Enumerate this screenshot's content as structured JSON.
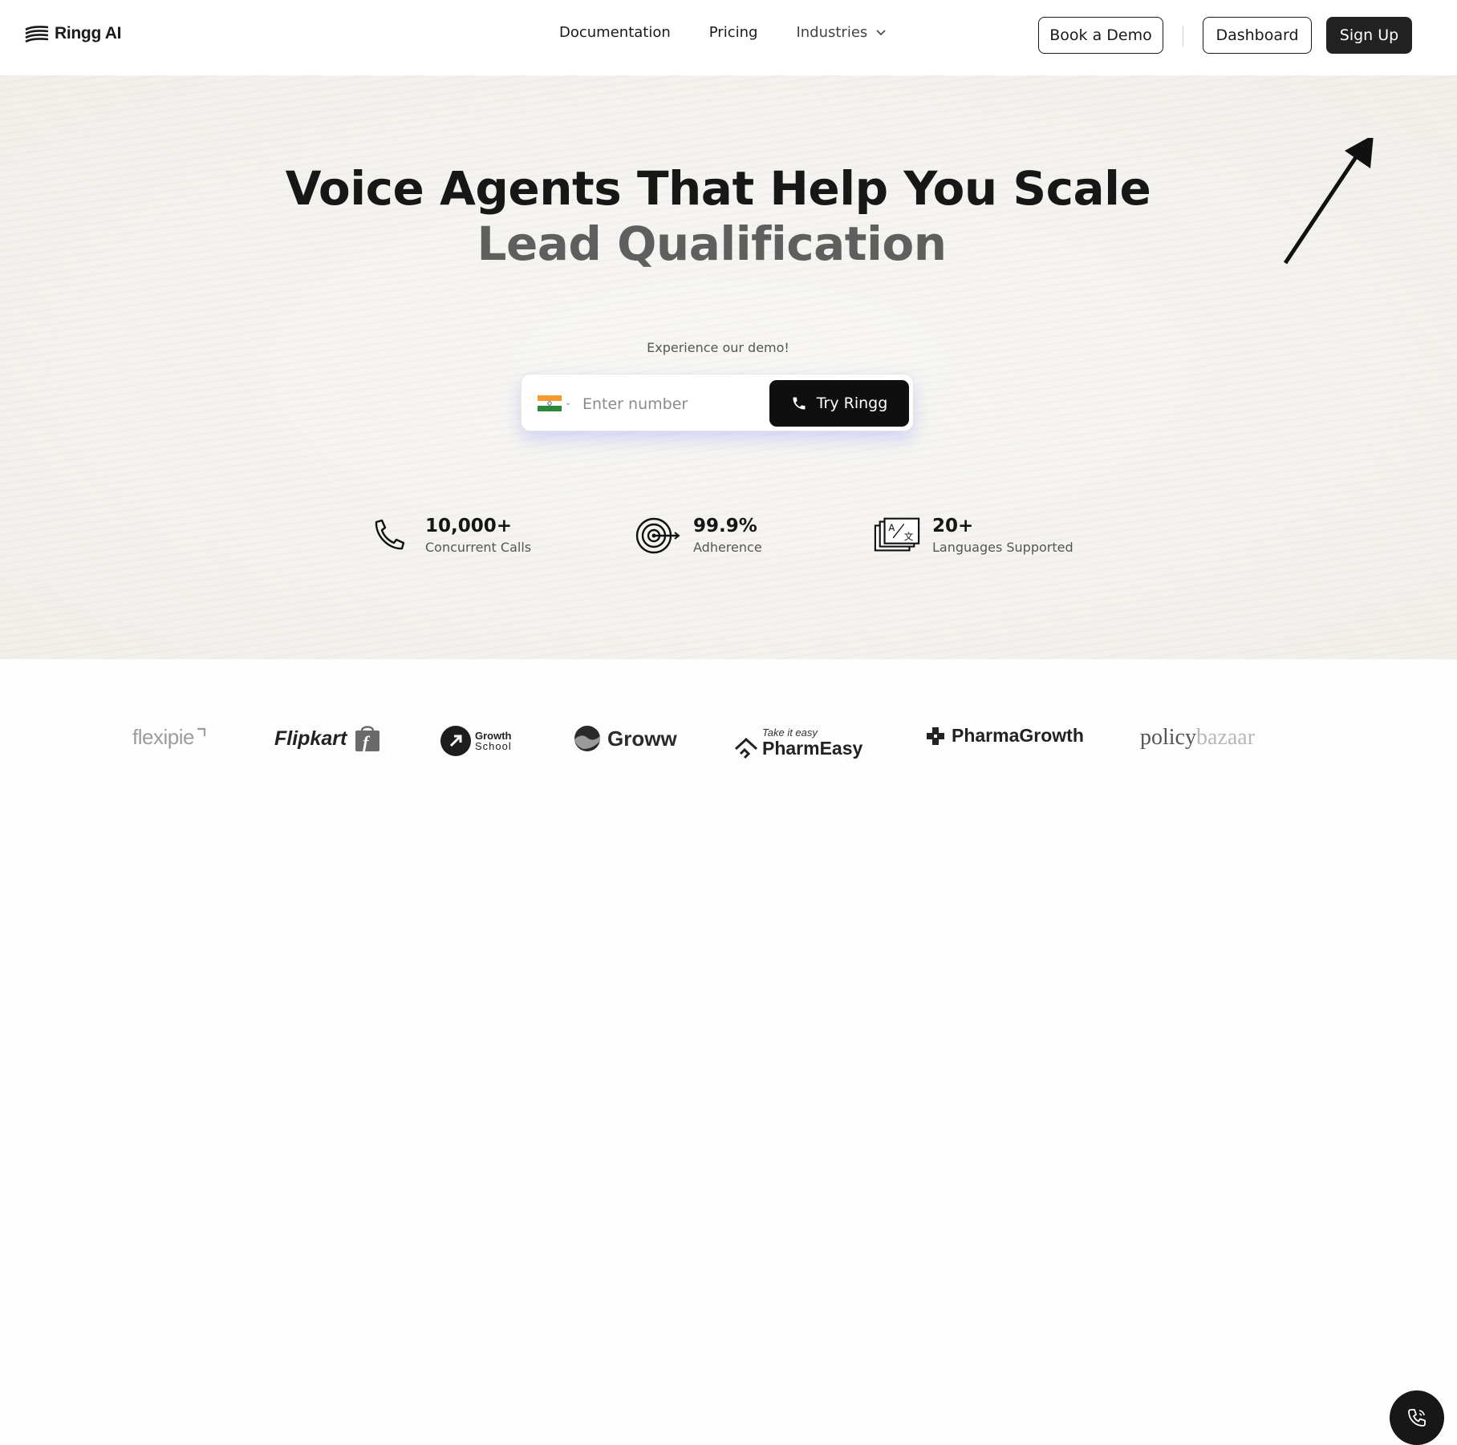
{
  "brand": {
    "name": "Ringg AI"
  },
  "nav": {
    "documentation": "Documentation",
    "pricing": "Pricing",
    "industries": "Industries"
  },
  "header_buttons": {
    "book_demo": "Book a Demo",
    "dashboard": "Dashboard",
    "sign_up": "Sign Up"
  },
  "hero": {
    "title": "Voice Agents That Help You Scale",
    "subtitle": "Lead Qualification"
  },
  "demo": {
    "label": "Experience our demo!",
    "placeholder": "Enter number",
    "country_flag": "india-flag",
    "try_label": "Try Ringg"
  },
  "stats": [
    {
      "value": "10,000+",
      "label": "Concurrent Calls",
      "icon": "phone-icon"
    },
    {
      "value": "99.9%",
      "label": "Adherence",
      "icon": "target-icon"
    },
    {
      "value": "20+",
      "label": "Languages Supported",
      "icon": "translate-icon"
    }
  ],
  "logos": {
    "flexipie": "flexipie",
    "flipkart": "Flipkart",
    "growth_school": {
      "line1": "Growth",
      "line2": "School"
    },
    "groww": "Groww",
    "pharmeasy": {
      "tagline": "Take it easy",
      "name": "PharmEasy"
    },
    "pharmagrowth": "PharmaGrowth",
    "policybazaar": {
      "part1": "policy",
      "part2": "bazaar"
    }
  },
  "colors": {
    "dark": "#171717",
    "subtitle_grey": "#5f5f5f",
    "demo_glow": "#8c96f5"
  }
}
